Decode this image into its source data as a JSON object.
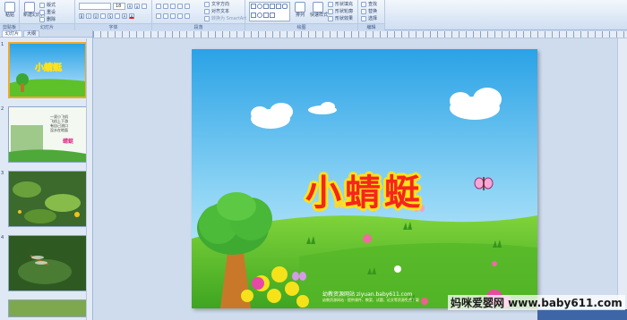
{
  "ribbon": {
    "groups": {
      "clipboard": "剪贴板",
      "slides": "幻灯片",
      "font": "字体",
      "paragraph": "段落",
      "drawing": "绘图",
      "editing": "编辑"
    },
    "buttons": {
      "paste": "粘贴",
      "new_slide": "新建幻灯片",
      "layout": "版式",
      "reset": "重设",
      "delete": "删除",
      "arrange": "排列",
      "quick_styles": "快速样式",
      "find": "查找",
      "replace": "替换",
      "select": "选择"
    },
    "font_size": "18",
    "text_direction": "文字方向",
    "align_text": "对齐文本",
    "smartart": "转换为 SmartArt",
    "shape_fill": "形状填充",
    "shape_outline": "形状轮廓",
    "shape_effects": "形状效果"
  },
  "left_panel": {
    "tabs": [
      "幻灯片",
      "大纲"
    ],
    "slide_numbers": [
      "1",
      "2",
      "3",
      "4"
    ],
    "thumb1_title": "小蜻蜓",
    "thumb2_lines": [
      "一双小飞机",
      "飞机上下游",
      "有自己流口",
      "没水在地面"
    ],
    "thumb2_word": "蜻蜓"
  },
  "slide": {
    "title": "小蜻蜓",
    "site": "幼教资源网站 ziyuan.baby611.com",
    "small_text": "幼教资源网站 · 提供课件、教案、试题、论文等资源免费下载"
  },
  "watermark": "妈咪爱婴网 www.baby611.com",
  "colors": {
    "title_red": "#f5261c",
    "title_outline": "#ffe21a",
    "sky_top": "#2aa2e6",
    "grass": "#5ec12a"
  }
}
